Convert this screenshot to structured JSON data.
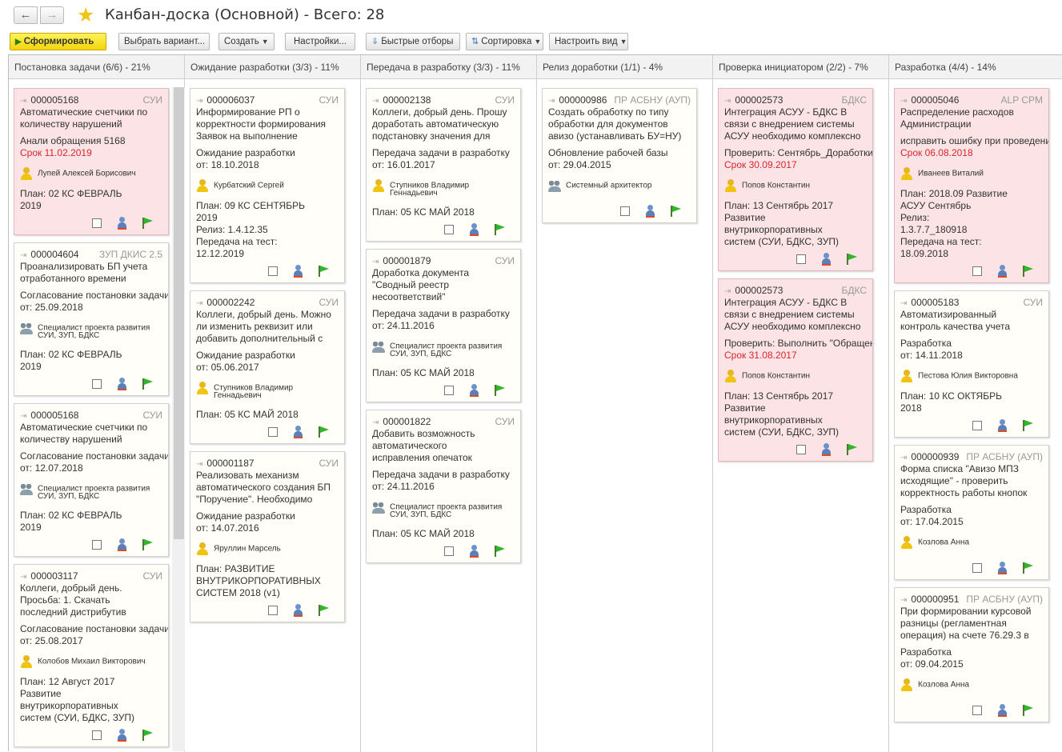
{
  "window": {
    "title": "Канбан-доска (Основной) - Всего: 28",
    "back_icon": "arrow-left-icon",
    "forward_icon": "arrow-right-icon",
    "favorite_icon": "star-icon"
  },
  "toolbar": {
    "generate": "Сформировать",
    "choose_variant": "Выбрать вариант...",
    "create": "Создать",
    "settings": "Настройки...",
    "quick_filters": "Быстрые отборы",
    "sorting": "Сортировка",
    "view_setup": "Настроить вид"
  },
  "columns": [
    {
      "title": "Постановка задачи (6/6) - 21%",
      "cards": [
        {
          "id": "000005168",
          "tag": "СУИ",
          "red": true,
          "lines": [
            {
              "t": "Автоматические счетчики по"
            },
            {
              "t": "количеству нарушений"
            },
            {
              "t": "Анали обращения 5168",
              "gap": true
            },
            {
              "t": "Срок 11.02.2019",
              "red": true
            }
          ],
          "person": {
            "name": "Лупей Алексей Борисович",
            "icon": "user-icon",
            "two": false
          },
          "plan": [
            "План: 02 КС ФЕВРАЛЬ",
            "2019"
          ]
        },
        {
          "id": "000004604",
          "tag": "ЗУП ДКИС 2.5",
          "red": false,
          "lines": [
            {
              "t": "Проанализировать БП учета"
            },
            {
              "t": "отработанного времени"
            },
            {
              "t": "Согласование постановки задачи",
              "gap": true
            },
            {
              "t": "от: 25.09.2018"
            }
          ],
          "person": {
            "name": "Специалист проекта развития",
            "name2": "СУИ, ЗУП, БДКС",
            "icon": "group-icon",
            "two": true
          },
          "plan": [
            "План: 02 КС ФЕВРАЛЬ",
            "2019"
          ]
        },
        {
          "id": "000005168",
          "tag": "СУИ",
          "red": false,
          "lines": [
            {
              "t": "Автоматические счетчики по"
            },
            {
              "t": "количеству нарушений"
            },
            {
              "t": "Согласование постановки задачи",
              "gap": true
            },
            {
              "t": "от: 12.07.2018"
            }
          ],
          "person": {
            "name": "Специалист проекта развития",
            "name2": "СУИ, ЗУП, БДКС",
            "icon": "group-icon",
            "two": true
          },
          "plan": [
            "План: 02 КС ФЕВРАЛЬ",
            "2019"
          ]
        },
        {
          "id": "000003117",
          "tag": "СУИ",
          "red": false,
          "lines": [
            {
              "t": "Коллеги, добрый день."
            },
            {
              "t": "Просьба: 1. Скачать"
            },
            {
              "t": "последний дистрибутив"
            },
            {
              "t": "Согласование постановки задачи",
              "gap": true
            },
            {
              "t": "от: 25.08.2017"
            }
          ],
          "person": {
            "name": "Колобов Михаил Викторович",
            "icon": "user-icon",
            "two": false
          },
          "plan": [
            "План: 12 Август 2017",
            "Развитие",
            "внутрикорпоративных",
            "систем (СУИ, БДКС, ЗУП)"
          ]
        }
      ]
    },
    {
      "title": "Ожидание разработки (3/3) - 11%",
      "cards": [
        {
          "id": "000006037",
          "tag": "СУИ",
          "red": false,
          "lines": [
            {
              "t": "Информирование РП о"
            },
            {
              "t": "корректности формирования"
            },
            {
              "t": "Заявок на выполнение"
            },
            {
              "t": "Ожидание разработки",
              "gap": true
            },
            {
              "t": "от: 18.10.2018"
            }
          ],
          "person": {
            "name": "Курбатский Сергей",
            "icon": "user-icon",
            "two": false
          },
          "plan": [
            "План: 09 КС СЕНТЯБРЬ",
            "2019",
            "Релиз: 1.4.12.35",
            "Передача на тест:",
            "12.12.2019"
          ]
        },
        {
          "id": "000002242",
          "tag": "СУИ",
          "red": false,
          "lines": [
            {
              "t": "Коллеги, добрый день. Можно"
            },
            {
              "t": "ли изменить реквизит или"
            },
            {
              "t": "добавить дополнительный с"
            },
            {
              "t": "Ожидание разработки",
              "gap": true
            },
            {
              "t": "от: 05.06.2017"
            }
          ],
          "person": {
            "name": "Ступников Владимир",
            "name2": "Геннадьевич",
            "icon": "user-icon",
            "two": true
          },
          "plan": [
            "План: 05 КС МАЙ 2018"
          ]
        },
        {
          "id": "000001187",
          "tag": "СУИ",
          "red": false,
          "lines": [
            {
              "t": "Реализовать механизм"
            },
            {
              "t": "автоматического создания БП"
            },
            {
              "t": "\"Поручение\". Необходимо"
            },
            {
              "t": "Ожидание разработки",
              "gap": true
            },
            {
              "t": "от: 14.07.2016"
            }
          ],
          "person": {
            "name": "Яруллин Марсель",
            "icon": "user-icon",
            "two": false
          },
          "plan": [
            "План: РАЗВИТИЕ",
            "ВНУТРИКОРПОРАТИВНЫХ",
            "СИСТЕМ 2018 (v1)"
          ]
        }
      ]
    },
    {
      "title": "Передача в разработку (3/3) - 11%",
      "cards": [
        {
          "id": "000002138",
          "tag": "СУИ",
          "red": false,
          "lines": [
            {
              "t": "Коллеги, добрый день. Прошу"
            },
            {
              "t": "доработать автоматическую"
            },
            {
              "t": "подстановку значения для"
            },
            {
              "t": "Передача задачи в разработку",
              "gap": true
            },
            {
              "t": "от: 16.01.2017"
            }
          ],
          "person": {
            "name": "Ступников Владимир",
            "name2": "Геннадьевич",
            "icon": "user-icon",
            "two": true
          },
          "plan": [
            "План: 05 КС МАЙ 2018"
          ]
        },
        {
          "id": "000001879",
          "tag": "СУИ",
          "red": false,
          "lines": [
            {
              "t": "Доработка документа"
            },
            {
              "t": "\"Сводный реестр"
            },
            {
              "t": "несоответствий\""
            },
            {
              "t": "Передача задачи в разработку",
              "gap": true
            },
            {
              "t": "от: 24.11.2016"
            }
          ],
          "person": {
            "name": "Специалист проекта развития",
            "name2": "СУИ, ЗУП, БДКС",
            "icon": "group-icon",
            "two": true
          },
          "plan": [
            "План: 05 КС МАЙ 2018"
          ]
        },
        {
          "id": "000001822",
          "tag": "СУИ",
          "red": false,
          "lines": [
            {
              "t": "Добавить возможность"
            },
            {
              "t": "автоматического"
            },
            {
              "t": "исправления опечаток"
            },
            {
              "t": "Передача задачи в разработку",
              "gap": true
            },
            {
              "t": "от: 24.11.2016"
            }
          ],
          "person": {
            "name": "Специалист проекта развития",
            "name2": "СУИ, ЗУП, БДКС",
            "icon": "group-icon",
            "two": true
          },
          "plan": [
            "План: 05 КС МАЙ 2018"
          ]
        }
      ]
    },
    {
      "title": "Релиз доработки (1/1) - 4%",
      "cards": [
        {
          "id": "000000986",
          "tag": "ПР АСБНУ (АУП)",
          "red": false,
          "lines": [
            {
              "t": "Создать обработку по типу"
            },
            {
              "t": "обработки для документов"
            },
            {
              "t": "авизо (устанавливать БУ=НУ)"
            },
            {
              "t": "Обновление рабочей базы",
              "gap": true
            },
            {
              "t": "от: 29.04.2015"
            }
          ],
          "person": {
            "name": "Системный архитектор",
            "icon": "group-icon",
            "two": false
          },
          "plan": []
        }
      ]
    },
    {
      "title": "Проверка инициатором (2/2) - 7%",
      "cards": [
        {
          "id": "000002573",
          "tag": "БДКС",
          "red": true,
          "lines": [
            {
              "t": "Интеграция АСУУ - БДКС В"
            },
            {
              "t": "связи с внедрением системы"
            },
            {
              "t": "АСУУ необходимо комплексно"
            },
            {
              "t": "Проверить: Сентябрь_Доработки",
              "gap": true
            },
            {
              "t": "Срок 30.09.2017",
              "red": true
            }
          ],
          "person": {
            "name": "Попов Константин",
            "icon": "user-icon",
            "two": false
          },
          "plan": [
            "План: 13 Сентябрь 2017",
            "Развитие",
            "внутрикорпоративных",
            "систем (СУИ, БДКС, ЗУП)"
          ]
        },
        {
          "id": "000002573",
          "tag": "БДКС",
          "red": true,
          "lines": [
            {
              "t": "Интеграция АСУУ - БДКС В"
            },
            {
              "t": "связи с внедрением системы"
            },
            {
              "t": "АСУУ необходимо комплексно"
            },
            {
              "t": "Проверить: Выполнить \"Обращение\"",
              "gap": true
            },
            {
              "t": "Срок 31.08.2017",
              "red": true
            }
          ],
          "person": {
            "name": "Попов Константин",
            "icon": "user-icon",
            "two": false
          },
          "plan": [
            "План: 13 Сентябрь 2017",
            "Развитие",
            "внутрикорпоративных",
            "систем (СУИ, БДКС, ЗУП)"
          ]
        }
      ]
    },
    {
      "title": "Разработка (4/4) - 14%",
      "cards": [
        {
          "id": "000005046",
          "tag": "ALP CPM",
          "red": true,
          "lines": [
            {
              "t": "Распределение расходов"
            },
            {
              "t": "Администрации"
            },
            {
              "t": "исправить ошибку при проведении",
              "gap": true
            },
            {
              "t": "Срок 06.08.2018",
              "red": true
            }
          ],
          "person": {
            "name": "Иванеев Виталий",
            "icon": "user-icon",
            "two": false
          },
          "plan": [
            "План: 2018.09 Развитие",
            "АСУУ Сентябрь",
            "Релиз:",
            "1.3.7.7_180918",
            "Передача на тест:",
            "18.09.2018"
          ]
        },
        {
          "id": "000005183",
          "tag": "СУИ",
          "red": false,
          "lines": [
            {
              "t": "Автоматизированный"
            },
            {
              "t": "контроль качества учета"
            },
            {
              "t": "Разработка",
              "gap": true
            },
            {
              "t": "от: 14.11.2018"
            }
          ],
          "person": {
            "name": "Пестова Юлия Викторовна",
            "icon": "user-icon",
            "two": false
          },
          "plan": [
            "План: 10 КС ОКТЯБРЬ",
            "2018"
          ]
        },
        {
          "id": "000000939",
          "tag": "ПР АСБНУ (АУП)",
          "red": false,
          "lines": [
            {
              "t": "Форма списка \"Авизо МПЗ"
            },
            {
              "t": "исходящие\" - проверить"
            },
            {
              "t": "корректность работы кнопок"
            },
            {
              "t": "Разработка",
              "gap": true
            },
            {
              "t": "от: 17.04.2015"
            }
          ],
          "person": {
            "name": "Козлова Анна",
            "icon": "user-icon",
            "two": false
          },
          "plan": []
        },
        {
          "id": "000000951",
          "tag": "ПР АСБНУ (АУП)",
          "red": false,
          "lines": [
            {
              "t": "При формировании курсовой"
            },
            {
              "t": "разницы (регламентная"
            },
            {
              "t": "операция) на счете 76.29.3 в"
            },
            {
              "t": "Разработка",
              "gap": true
            },
            {
              "t": "от: 09.04.2015"
            }
          ],
          "person": {
            "name": "Козлова Анна",
            "icon": "user-icon",
            "two": false
          },
          "plan": []
        }
      ]
    }
  ]
}
